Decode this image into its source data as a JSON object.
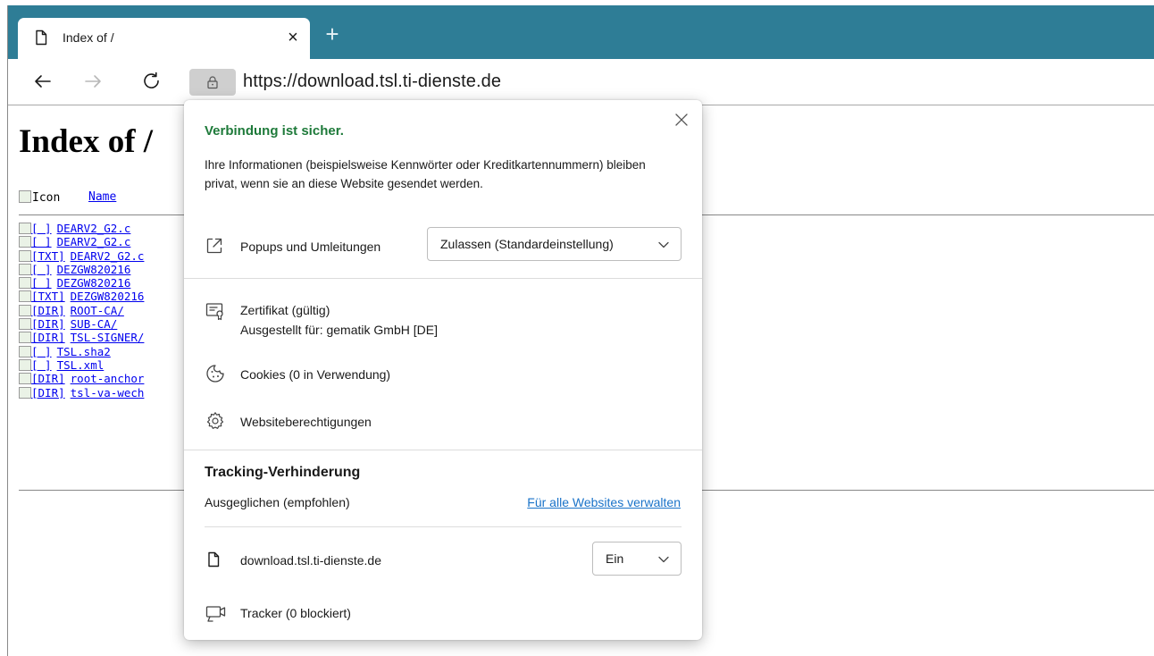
{
  "tab": {
    "title": "Index of /",
    "close_glyph": "×",
    "new_tab_glyph": "+"
  },
  "toolbar": {
    "url": "https://download.tsl.ti-dienste.de"
  },
  "page": {
    "heading": "Index of /",
    "header_icon_alt": "Icon",
    "header_name": "Name",
    "rows": [
      {
        "alt": "[   ]",
        "name": "DEARV2_G2.c"
      },
      {
        "alt": "[   ]",
        "name": "DEARV2_G2.c"
      },
      {
        "alt": "[TXT]",
        "name": "DEARV2_G2.c"
      },
      {
        "alt": "[   ]",
        "name": "DEZGW820216"
      },
      {
        "alt": "[   ]",
        "name": "DEZGW820216"
      },
      {
        "alt": "[TXT]",
        "name": "DEZGW820216"
      },
      {
        "alt": "[DIR]",
        "name": "ROOT-CA/"
      },
      {
        "alt": "[DIR]",
        "name": "SUB-CA/"
      },
      {
        "alt": "[DIR]",
        "name": "TSL-SIGNER/"
      },
      {
        "alt": "[   ]",
        "name": "TSL.sha2"
      },
      {
        "alt": "[   ]",
        "name": "TSL.xml"
      },
      {
        "alt": "[DIR]",
        "name": "root-anchor"
      },
      {
        "alt": "[DIR]",
        "name": "tsl-va-wech"
      }
    ]
  },
  "popup": {
    "secure_title": "Verbindung ist sicher.",
    "secure_desc": "Ihre Informationen (beispielsweise Kennwörter oder Kreditkartennummern) bleiben privat, wenn sie an diese Website gesendet werden.",
    "popups_label": "Popups und Umleitungen",
    "popups_value": "Zulassen (Standardeinstellung)",
    "cert_line1": "Zertifikat (gültig)",
    "cert_line2": "Ausgestellt für: gematik GmbH [DE]",
    "cookies": "Cookies (0 in Verwendung)",
    "site_perms": "Websiteberechtigungen",
    "tracking_title": "Tracking-Verhinderung",
    "tracking_level": "Ausgeglichen (empfohlen)",
    "tracking_link": "Für alle Websites verwalten",
    "site_domain": "download.tsl.ti-dienste.de",
    "site_toggle": "Ein",
    "trackers": "Tracker (0 blockiert)"
  },
  "colors": {
    "tabstrip": "#2e7d96",
    "secure_green": "#1e7a3a",
    "link_blue": "#1a73c9",
    "page_link": "#0000ee"
  },
  "icons": [
    "page-icon",
    "close-icon",
    "plus-icon",
    "back-arrow-icon",
    "forward-arrow-icon",
    "reload-icon",
    "lock-icon",
    "external-link-icon",
    "chevron-down-icon",
    "certificate-icon",
    "cookie-icon",
    "gear-icon",
    "tracker-icon"
  ]
}
